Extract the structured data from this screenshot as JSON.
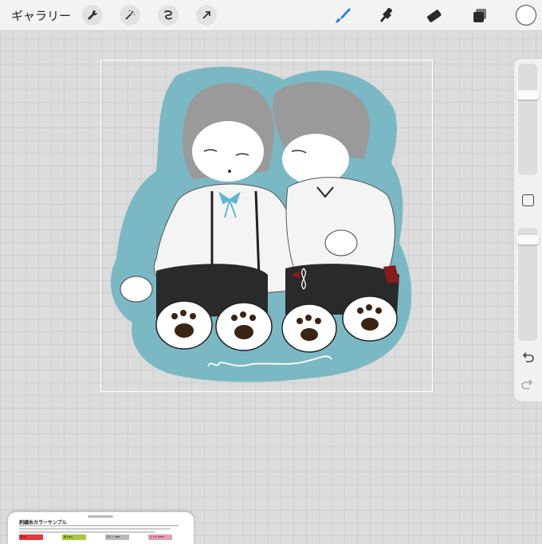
{
  "topbar": {
    "gallery_label": "ギャラリー",
    "tools_left": [
      {
        "name": "wrench-icon"
      },
      {
        "name": "magic-wand-icon"
      },
      {
        "name": "selection-icon"
      },
      {
        "name": "transform-arrow-icon"
      }
    ],
    "tools_right": [
      {
        "name": "brush-icon",
        "active_color": "#2f7de1"
      },
      {
        "name": "smudge-icon"
      },
      {
        "name": "eraser-icon"
      },
      {
        "name": "layers-icon"
      }
    ],
    "current_color": "#ffffff"
  },
  "sidebar": {
    "brush_size_level": 0.74,
    "opacity_level": 0.93
  },
  "reference_panel": {
    "title": "刺繍糸カラーサンプル",
    "chips": [
      {
        "color": "#e43a3a",
        "label": "赤 (1)"
      },
      {
        "color": "#a8c83a",
        "label": "緑 (234)"
      },
      {
        "color": "#b9b9b9",
        "label": "グレー (535)"
      },
      {
        "color": "#e8a0b0",
        "label": "ピンク (3761)"
      }
    ]
  },
  "colors": {
    "sticker_bg": "#7ab8c4",
    "accent": "#2f7de1",
    "ribbon": "#5cb8d0",
    "red_accent": "#8a1a1a"
  }
}
